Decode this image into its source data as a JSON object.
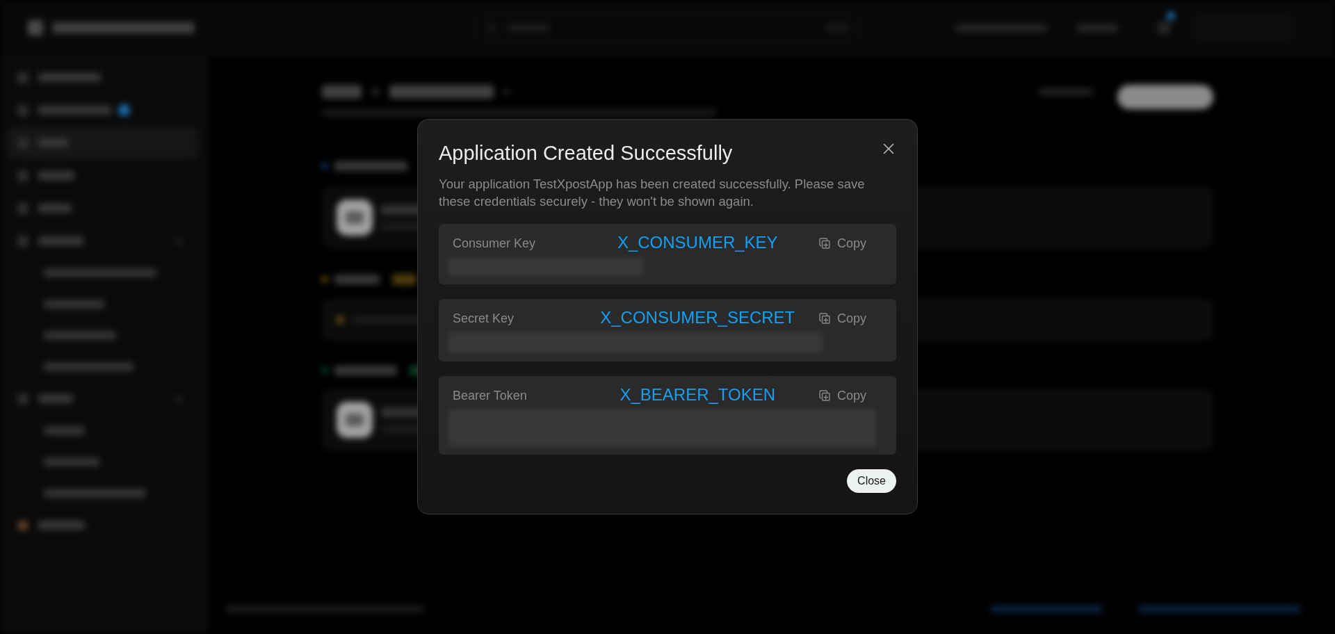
{
  "dialog": {
    "title": "Application Created Successfully",
    "message": "Your application TestXpostApp has been created successfully. Please save these credentials securely - they won't be shown again.",
    "credentials": [
      {
        "label": "Consumer Key",
        "annotation": "X_CONSUMER_KEY",
        "copy": "Copy",
        "redacted": true
      },
      {
        "label": "Secret Key",
        "annotation": "X_CONSUMER_SECRET",
        "copy": "Copy",
        "redacted": true
      },
      {
        "label": "Bearer Token",
        "annotation": "X_BEARER_TOKEN",
        "copy": "Copy",
        "redacted": true
      }
    ],
    "close_button": "Close"
  }
}
